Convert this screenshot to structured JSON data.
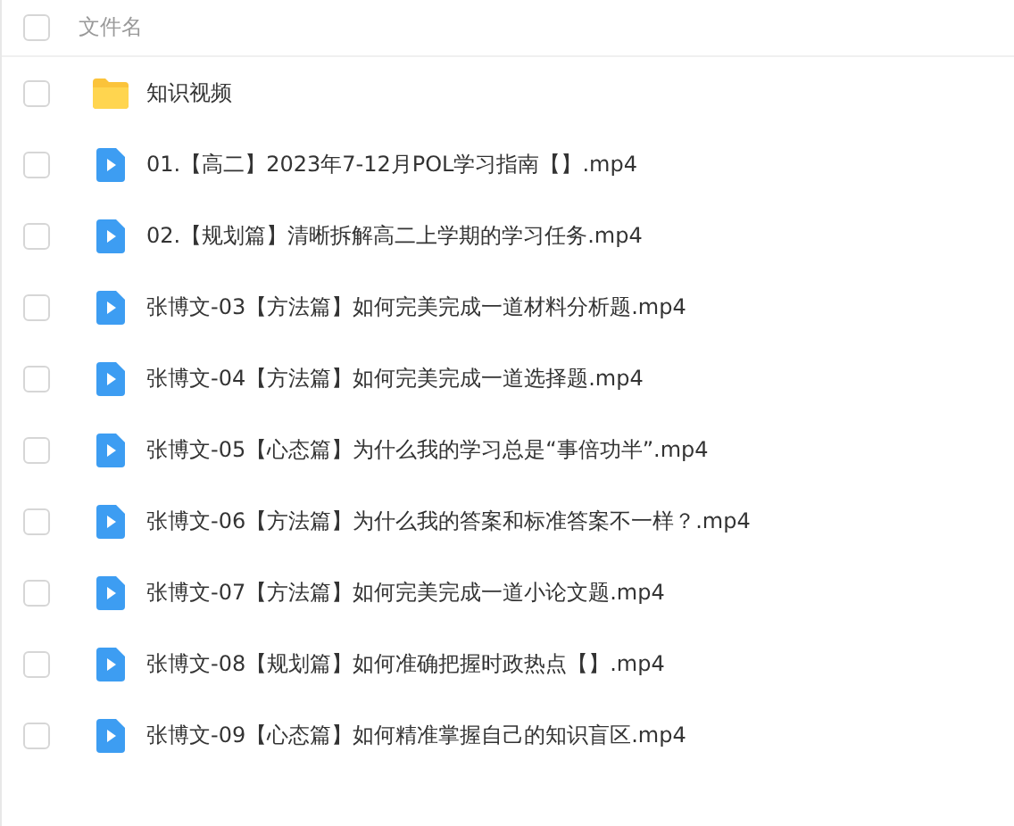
{
  "header": {
    "checked": false,
    "label": "文件名"
  },
  "files": [
    {
      "kind": "folder",
      "name": "知识视频",
      "checked": false
    },
    {
      "kind": "video",
      "name": "01.【高二】2023年7-12月POL学习指南【】.mp4",
      "checked": false
    },
    {
      "kind": "video",
      "name": "02.【规划篇】清晰拆解高二上学期的学习任务.mp4",
      "checked": false
    },
    {
      "kind": "video",
      "name": "张博文-03【方法篇】如何完美完成一道材料分析题.mp4",
      "checked": false
    },
    {
      "kind": "video",
      "name": "张博文-04【方法篇】如何完美完成一道选择题.mp4",
      "checked": false
    },
    {
      "kind": "video",
      "name": "张博文-05【心态篇】为什么我的学习总是“事倍功半”.mp4",
      "checked": false
    },
    {
      "kind": "video",
      "name": "张博文-06【方法篇】为什么我的答案和标准答案不一样？.mp4",
      "checked": false
    },
    {
      "kind": "video",
      "name": "张博文-07【方法篇】如何完美完成一道小论文题.mp4",
      "checked": false
    },
    {
      "kind": "video",
      "name": "张博文-08【规划篇】如何准确把握时政热点【】.mp4",
      "checked": false
    },
    {
      "kind": "video",
      "name": "张博文-09【心态篇】如何精准掌握自己的知识盲区.mp4",
      "checked": false
    }
  ]
}
